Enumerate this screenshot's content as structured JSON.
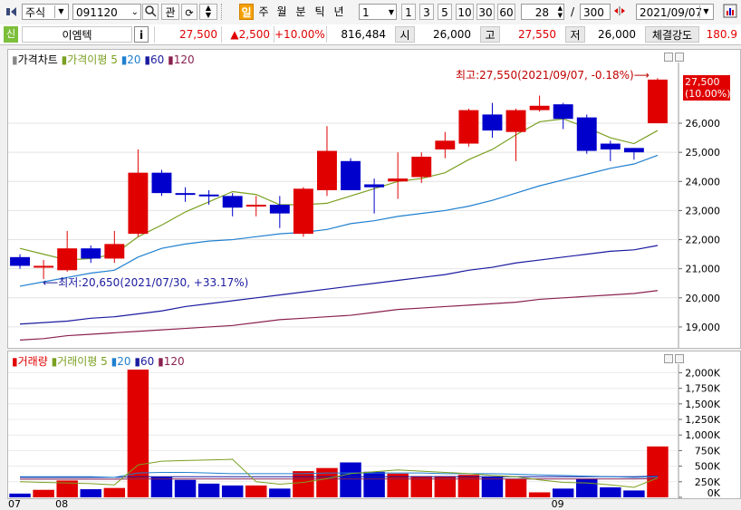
{
  "toolbar": {
    "market": "주식",
    "code": "091120",
    "gwan": "관",
    "periods": [
      "일",
      "주",
      "월",
      "분",
      "틱",
      "년"
    ],
    "active_period": "일",
    "interval": "1",
    "counts": [
      "1",
      "3",
      "5",
      "10",
      "30",
      "60"
    ],
    "bars_shown": "28",
    "bars_total": "300",
    "date": "2021/09/07"
  },
  "info": {
    "tag": "신",
    "name": "이엠텍",
    "info_btn": "i",
    "price": "27,500",
    "change": "▲2,500",
    "rate": "+10.00%",
    "volume": "816,484",
    "open_label": "시",
    "open": "26,000",
    "high_label": "고",
    "high": "27,550",
    "low_label": "저",
    "low": "26,000",
    "strength_label": "체결강도",
    "strength": "180.9"
  },
  "price_panel": {
    "legend_title": "가격차트",
    "ma_label": "가격이평",
    "ma_periods": [
      "5",
      "20",
      "60",
      "120"
    ],
    "ma_colors": [
      "#7aa020",
      "#2080d0",
      "#1a1aa0",
      "#8a2050"
    ],
    "max_note": "최고:27,550(2021/09/07, -0.18%)",
    "min_note": "최저:20,650(2021/07/30, +33.17%)",
    "last_price": "27,500",
    "last_rate": "(10.00%)",
    "y_ticks": [
      "19,000",
      "20,000",
      "21,000",
      "22,000",
      "23,000",
      "24,000",
      "25,000",
      "26,000"
    ]
  },
  "volume_panel": {
    "legend_title": "거래량",
    "ma_label": "거래이평",
    "ma_periods": [
      "5",
      "20",
      "60",
      "120"
    ],
    "y_ticks": [
      "0K",
      "250K",
      "500K",
      "750K",
      "1,000K",
      "1,250K",
      "1,500K",
      "1,750K",
      "2,000K"
    ]
  },
  "x_labels": [
    "07",
    "08",
    "09"
  ],
  "chart_data": [
    {
      "type": "candlestick",
      "title": "가격차트",
      "ylim": [
        18500,
        27900
      ],
      "candles": [
        {
          "o": 21400,
          "h": 21500,
          "l": 21000,
          "c": 21100
        },
        {
          "o": 21100,
          "h": 21300,
          "l": 20650,
          "c": 21100
        },
        {
          "o": 20950,
          "h": 22300,
          "l": 20900,
          "c": 21700
        },
        {
          "o": 21700,
          "h": 21800,
          "l": 21200,
          "c": 21350
        },
        {
          "o": 21350,
          "h": 22300,
          "l": 21200,
          "c": 21850
        },
        {
          "o": 22200,
          "h": 25100,
          "l": 22100,
          "c": 24300
        },
        {
          "o": 24300,
          "h": 24400,
          "l": 23500,
          "c": 23600
        },
        {
          "o": 23600,
          "h": 23800,
          "l": 23300,
          "c": 23550
        },
        {
          "o": 23550,
          "h": 23700,
          "l": 23200,
          "c": 23500
        },
        {
          "o": 23500,
          "h": 23600,
          "l": 22800,
          "c": 23100
        },
        {
          "o": 23150,
          "h": 23500,
          "l": 22800,
          "c": 23200
        },
        {
          "o": 23200,
          "h": 23500,
          "l": 22400,
          "c": 22900
        },
        {
          "o": 22200,
          "h": 23800,
          "l": 22100,
          "c": 23750
        },
        {
          "o": 23700,
          "h": 25900,
          "l": 23500,
          "c": 25050
        },
        {
          "o": 24700,
          "h": 24800,
          "l": 23700,
          "c": 23700
        },
        {
          "o": 23900,
          "h": 24100,
          "l": 22900,
          "c": 23800
        },
        {
          "o": 24000,
          "h": 25000,
          "l": 23400,
          "c": 24100
        },
        {
          "o": 24150,
          "h": 25000,
          "l": 23950,
          "c": 24850
        },
        {
          "o": 25100,
          "h": 25700,
          "l": 24800,
          "c": 25400
        },
        {
          "o": 25300,
          "h": 26500,
          "l": 25200,
          "c": 26450
        },
        {
          "o": 26300,
          "h": 26700,
          "l": 25500,
          "c": 25750
        },
        {
          "o": 25700,
          "h": 26500,
          "l": 24700,
          "c": 26450
        },
        {
          "o": 26450,
          "h": 26950,
          "l": 26400,
          "c": 26600
        },
        {
          "o": 26650,
          "h": 26700,
          "l": 25800,
          "c": 26150
        },
        {
          "o": 26200,
          "h": 26300,
          "l": 24950,
          "c": 25050
        },
        {
          "o": 25300,
          "h": 25400,
          "l": 24700,
          "c": 25100
        },
        {
          "o": 25150,
          "h": 25150,
          "l": 24750,
          "c": 25000
        },
        {
          "o": 26000,
          "h": 27550,
          "l": 26000,
          "c": 27500
        }
      ],
      "ma5": [
        21700,
        21500,
        21300,
        21350,
        21500,
        22100,
        22500,
        22950,
        23300,
        23650,
        23550,
        23200,
        23200,
        23250,
        23500,
        23750,
        24000,
        24100,
        24300,
        24750,
        25100,
        25600,
        26050,
        26150,
        25850,
        25500,
        25300,
        25750
      ],
      "ma20": [
        20400,
        20550,
        20700,
        20850,
        20950,
        21400,
        21700,
        21850,
        21950,
        22000,
        22100,
        22200,
        22250,
        22350,
        22550,
        22650,
        22800,
        22900,
        23000,
        23150,
        23350,
        23600,
        23850,
        24050,
        24250,
        24450,
        24600,
        24900
      ],
      "ma60": [
        19100,
        19150,
        19200,
        19300,
        19350,
        19450,
        19550,
        19700,
        19800,
        19900,
        20000,
        20100,
        20200,
        20300,
        20400,
        20500,
        20600,
        20700,
        20800,
        20950,
        21050,
        21200,
        21300,
        21400,
        21500,
        21600,
        21650,
        21800
      ],
      "ma120": [
        18550,
        18600,
        18700,
        18750,
        18800,
        18850,
        18900,
        18950,
        19000,
        19050,
        19150,
        19250,
        19300,
        19350,
        19400,
        19500,
        19600,
        19650,
        19700,
        19750,
        19800,
        19850,
        19950,
        20000,
        20050,
        20100,
        20150,
        20250
      ]
    },
    {
      "type": "bar",
      "title": "거래량",
      "ylim": [
        0,
        2050000
      ],
      "values": [
        60000,
        120000,
        270000,
        130000,
        150000,
        2050000,
        330000,
        280000,
        220000,
        190000,
        190000,
        140000,
        420000,
        470000,
        560000,
        410000,
        380000,
        340000,
        340000,
        360000,
        330000,
        290000,
        80000,
        140000,
        300000,
        160000,
        110000,
        816484
      ],
      "up": [
        false,
        true,
        true,
        false,
        true,
        true,
        false,
        false,
        false,
        false,
        true,
        false,
        true,
        true,
        false,
        false,
        true,
        true,
        true,
        true,
        false,
        true,
        true,
        false,
        false,
        false,
        false,
        true
      ],
      "ma5": [
        250000,
        240000,
        230000,
        220000,
        200000,
        520000,
        580000,
        590000,
        600000,
        610000,
        250000,
        210000,
        240000,
        300000,
        380000,
        410000,
        440000,
        420000,
        400000,
        380000,
        350000,
        330000,
        280000,
        240000,
        230000,
        200000,
        160000,
        310000
      ],
      "ma20": [
        330000,
        330000,
        330000,
        330000,
        320000,
        390000,
        400000,
        400000,
        390000,
        380000,
        380000,
        380000,
        380000,
        390000,
        390000,
        390000,
        390000,
        390000,
        380000,
        380000,
        380000,
        370000,
        360000,
        350000,
        340000,
        330000,
        320000,
        330000
      ],
      "ma60": [
        320000,
        320000,
        320000,
        320000,
        320000,
        330000,
        330000,
        330000,
        330000,
        330000,
        330000,
        330000,
        330000,
        330000,
        330000,
        330000,
        330000,
        330000,
        330000,
        330000,
        330000,
        330000,
        330000,
        330000,
        330000,
        330000,
        330000,
        340000
      ],
      "ma120": [
        290000,
        290000,
        290000,
        290000,
        290000,
        295000,
        295000,
        295000,
        295000,
        295000,
        295000,
        295000,
        295000,
        295000,
        295000,
        295000,
        295000,
        295000,
        295000,
        295000,
        295000,
        295000,
        295000,
        295000,
        295000,
        295000,
        295000,
        300000
      ]
    }
  ]
}
